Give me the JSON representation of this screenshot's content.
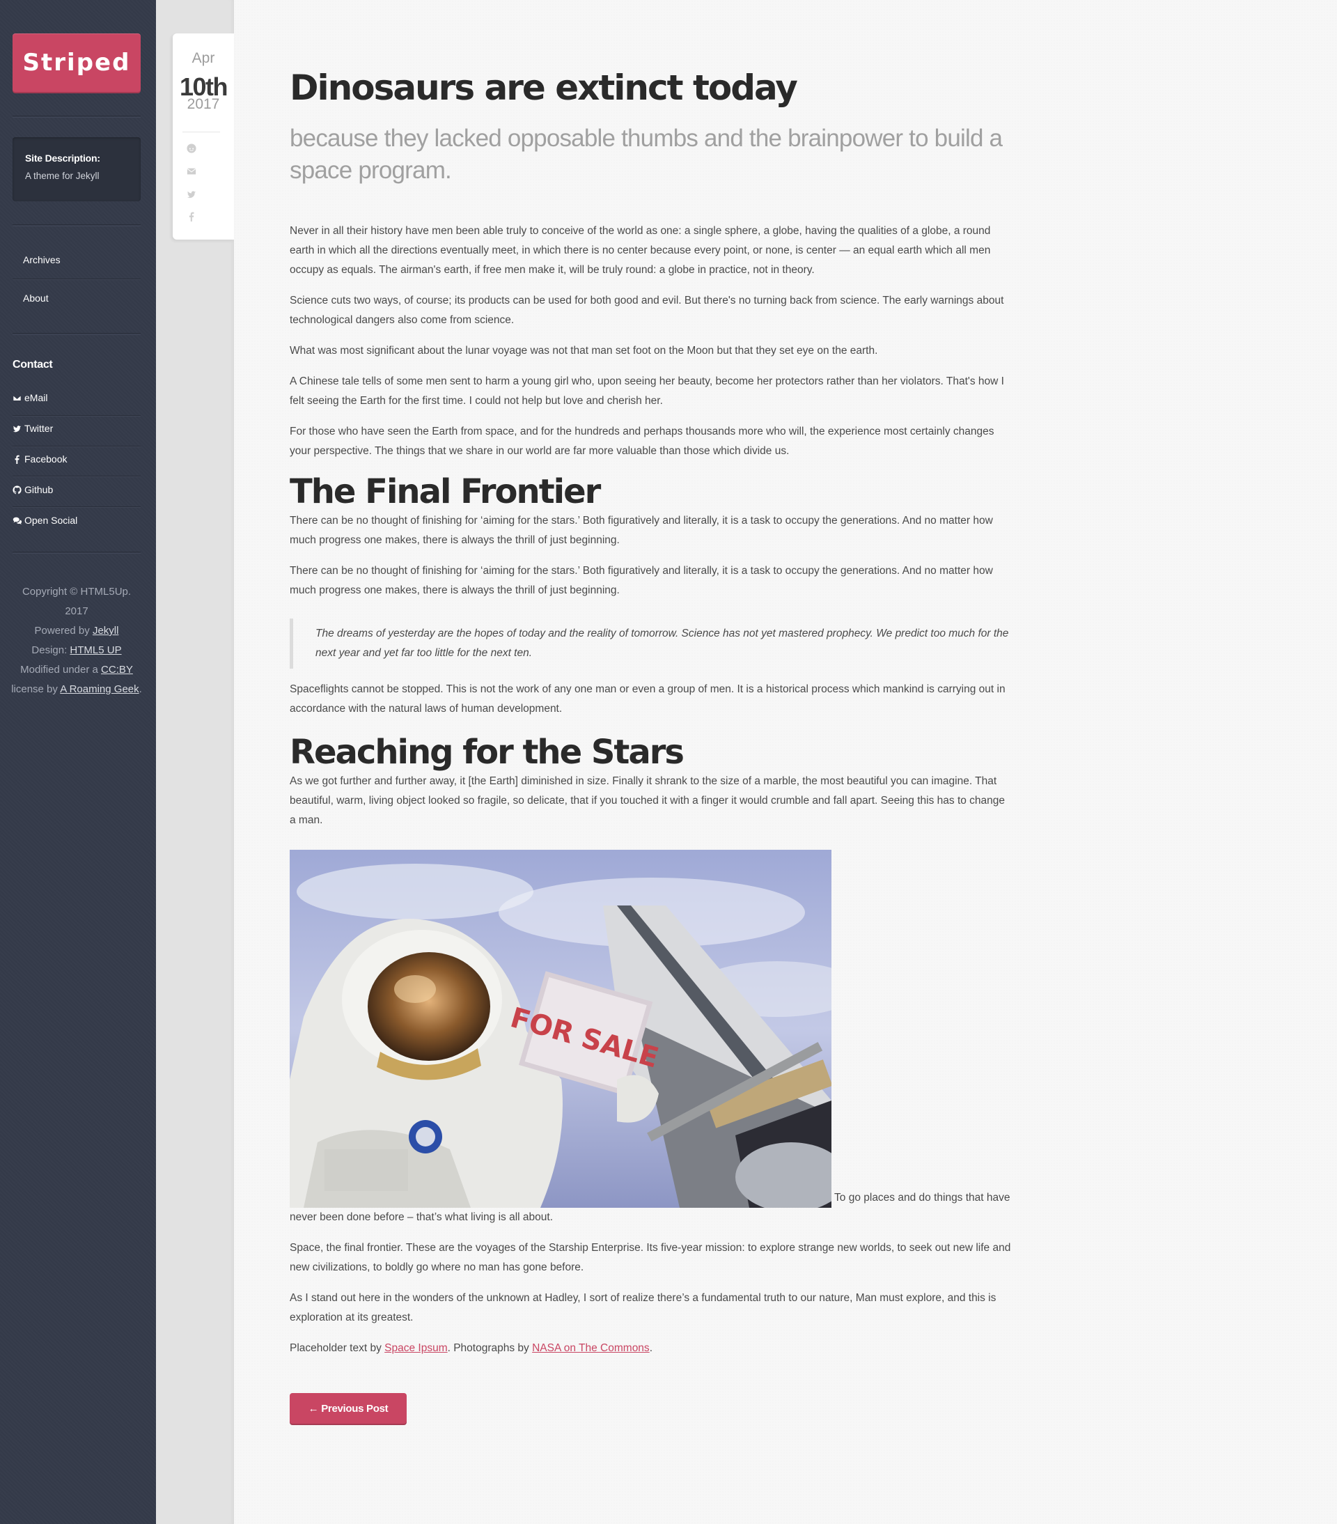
{
  "site": {
    "logo": "Striped",
    "description_title": "Site Description:",
    "description_text": "A theme for Jekyll"
  },
  "nav": [
    {
      "label": "Archives"
    },
    {
      "label": "About"
    }
  ],
  "contact": {
    "heading": "Contact",
    "items": [
      {
        "label": "eMail",
        "icon": "envelope-icon"
      },
      {
        "label": "Twitter",
        "icon": "twitter-icon"
      },
      {
        "label": "Facebook",
        "icon": "facebook-icon"
      },
      {
        "label": "Github",
        "icon": "github-icon"
      },
      {
        "label": "Open Social",
        "icon": "comments-icon"
      }
    ]
  },
  "footer": {
    "copyright": "Copyright © HTML5Up.",
    "year": "2017",
    "powered_prefix": "Powered by ",
    "powered_link": "Jekyll",
    "design_prefix": "Design: ",
    "design_link": "HTML5 UP",
    "modified_prefix": "Modified under a ",
    "modified_link": "CC:BY",
    "license_prefix": "license by ",
    "license_link": "A Roaming Geek",
    "license_suffix": "."
  },
  "date": {
    "month": "Apr",
    "day": "10th",
    "year": "2017"
  },
  "share_icons": [
    "reddit-icon",
    "envelope-icon",
    "twitter-icon",
    "facebook-icon"
  ],
  "post": {
    "title": "Dinosaurs are extinct today",
    "subtitle": "because they lacked opposable thumbs and the brainpower to build a space program.",
    "p1": "Never in all their history have men been able truly to conceive of the world as one: a single sphere, a globe, having the qualities of a globe, a round earth in which all the directions eventually meet, in which there is no center because every point, or none, is center — an equal earth which all men occupy as equals. The airman's earth, if free men make it, will be truly round: a globe in practice, not in theory.",
    "p2": "Science cuts two ways, of course; its products can be used for both good and evil. But there's no turning back from science. The early warnings about technological dangers also come from science.",
    "p3": "What was most significant about the lunar voyage was not that man set foot on the Moon but that they set eye on the earth.",
    "p4": "A Chinese tale tells of some men sent to harm a young girl who, upon seeing her beauty, become her protectors rather than her violators. That's how I felt seeing the Earth for the first time. I could not help but love and cherish her.",
    "p5": "For those who have seen the Earth from space, and for the hundreds and perhaps thousands more who will, the experience most certainly changes your perspective. The things that we share in our world are far more valuable than those which divide us.",
    "h2a": "The Final Frontier",
    "p6": "There can be no thought of finishing for ‘aiming for the stars.’ Both figuratively and literally, it is a task to occupy the generations. And no matter how much progress one makes, there is always the thrill of just beginning.",
    "p7": "There can be no thought of finishing for ‘aiming for the stars.’ Both figuratively and literally, it is a task to occupy the generations. And no matter how much progress one makes, there is always the thrill of just beginning.",
    "quote": "The dreams of yesterday are the hopes of today and the reality of tomorrow. Science has not yet mastered prophecy. We predict too much for the next year and yet far too little for the next ten.",
    "p8": "Spaceflights cannot be stopped. This is not the work of any one man or even a group of men. It is a historical process which mankind is carrying out in accordance with the natural laws of human development.",
    "h2b": "Reaching for the Stars",
    "p9": "As we got further and further away, it [the Earth] diminished in size. Finally it shrank to the size of a marble, the most beautiful you can imagine. That beautiful, warm, living object looked so fragile, so delicate, that if you touched it with a finger it would crumble and fall apart. Seeing this has to change a man.",
    "photo_sign": "FOR SALE",
    "p10": " To go places and do things that have never been done before – that’s what living is all about.",
    "p11": "Space, the final frontier. These are the voyages of the Starship Enterprise. Its five-year mission: to explore strange new worlds, to seek out new life and new civilizations, to boldly go where no man has gone before.",
    "p12": "As I stand out here in the wonders of the unknown at Hadley, I sort of realize there’s a fundamental truth to our nature, Man must explore, and this is exploration at its greatest.",
    "credits_a": "Placeholder text by ",
    "credits_link1": "Space Ipsum",
    "credits_b": ". Photographs by ",
    "credits_link2": "NASA on The Commons",
    "credits_c": "."
  },
  "pagination": {
    "prev_label": "← Previous Post"
  },
  "colors": {
    "accent": "#c94663",
    "sidebar": "#353b4a"
  }
}
